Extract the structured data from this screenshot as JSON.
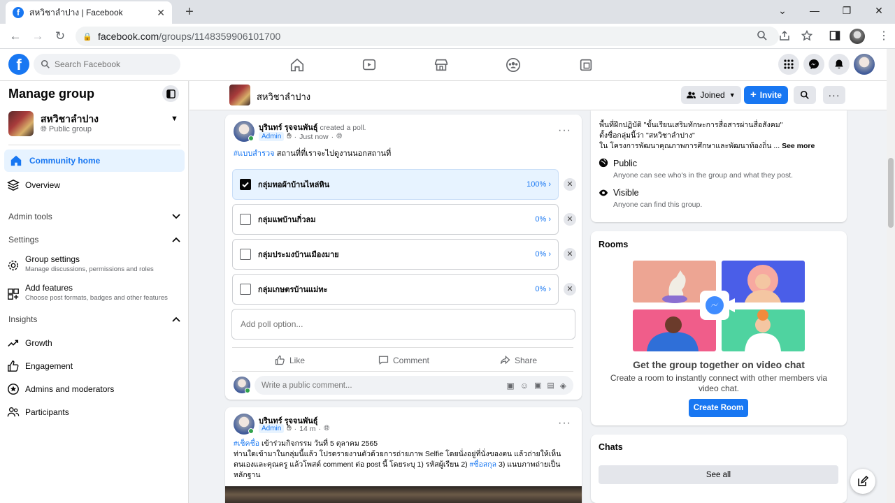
{
  "browser": {
    "tab_title": "สหวิชาลำปาง | Facebook",
    "url_host": "facebook.com",
    "url_path": "/groups/1148359906101700"
  },
  "fb": {
    "search_placeholder": "Search Facebook",
    "brand_color": "#1877f2"
  },
  "sidebar": {
    "title": "Manage group",
    "group_name": "สหวิชาลำปาง",
    "group_type": "Public group",
    "community_home": "Community home",
    "overview": "Overview",
    "admin_tools": "Admin tools",
    "settings": "Settings",
    "group_settings": {
      "label": "Group settings",
      "sub": "Manage discussions, permissions and roles"
    },
    "add_features": {
      "label": "Add features",
      "sub": "Choose post formats, badges and other features"
    },
    "insights": "Insights",
    "growth": "Growth",
    "engagement": "Engagement",
    "admins": "Admins and moderators",
    "participants": "Participants"
  },
  "group_header": {
    "name": "สหวิชาลำปาง",
    "joined": "Joined",
    "invite": "Invite"
  },
  "post1": {
    "author": "บุรินทร์ รุจจนพันธุ์",
    "action": "created a poll.",
    "badge": "Admin",
    "time": "Just now",
    "hashtag": "#แบบสำรวจ",
    "text": "สถานที่ที่เราจะไปดูงานนอกสถานที่",
    "options": [
      {
        "label": "กลุ่มทอผ้าบ้านไหล่หิน",
        "percent": "100%",
        "checked": true
      },
      {
        "label": "กลุ่มแพบ้านกิ่วลม",
        "percent": "0%",
        "checked": false
      },
      {
        "label": "กลุ่มประมงบ้านเมืองมาย",
        "percent": "0%",
        "checked": false
      },
      {
        "label": "กลุ่มเกษตรบ้านแม่ทะ",
        "percent": "0%",
        "checked": false
      }
    ],
    "add_option_placeholder": "Add poll option...",
    "like": "Like",
    "comment": "Comment",
    "share": "Share",
    "comment_placeholder": "Write a public comment..."
  },
  "post2": {
    "author": "บุรินทร์ รุจจนพันธุ์",
    "badge": "Admin",
    "time": "14 m",
    "hashtag1": "#เช็คชื่อ",
    "line1": "เข้าร่วมกิจกรรม วันที่ 5 ตุลาคม 2565",
    "line2": "ท่านใดเข้ามาในกลุ่มนี้แล้ว โปรดรายงานตัวด้วยการถ่ายภาพ Selfie โดยนั่งอยู่ที่นั่งของตน แล้วถ่ายให้เห็น",
    "line3a": "ตนเองและคุณครู แล้วโพสต์ comment ต่อ post นี้ โดยระบุ 1) รหัสผู้เรียน 2)",
    "hashtag2": "#ชื่อสกุล",
    "line3b": "3) แนบภาพถ่ายเป็น",
    "line4": "หลักฐาน"
  },
  "about": {
    "line1": "พื้นที่ฝึกปฏิบัติ \"ขั้นเรียนเสริมทักษะการสื่อสารผ่านสื่อสังคม\"",
    "line2": "ตั้งชื่อกลุ่มนี้ว่า \"สหวิชาลำปาง\"",
    "line3": "ใน โครงการพัฒนาคุณภาพการศึกษาและพัฒนาท้องถิ่น ...",
    "see_more": "See more",
    "public_title": "Public",
    "public_desc": "Anyone can see who's in the group and what they post.",
    "visible_title": "Visible",
    "visible_desc": "Anyone can find this group."
  },
  "rooms": {
    "title": "Rooms",
    "heading": "Get the group together on video chat",
    "desc": "Create a room to instantly connect with other members via video chat.",
    "button": "Create Room"
  },
  "chats": {
    "title": "Chats",
    "see_all": "See all"
  }
}
